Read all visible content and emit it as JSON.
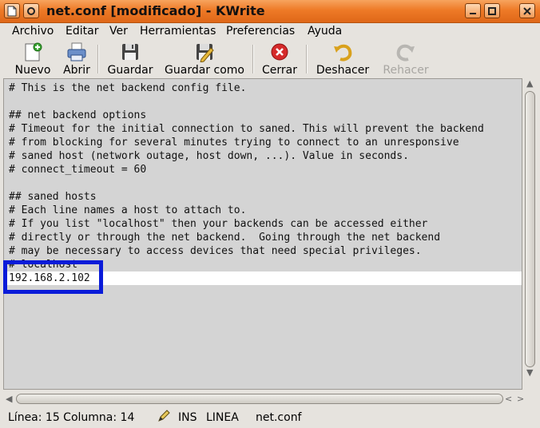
{
  "window": {
    "title": "net.conf [modificado] - KWrite",
    "icons": {
      "app": "document-icon",
      "menu": "window-menu-icon",
      "minimize": "minimize-icon",
      "maximize": "maximize-icon",
      "close": "close-x-icon"
    }
  },
  "menu": {
    "items": [
      "Archivo",
      "Editar",
      "Ver",
      "Herramientas",
      "Preferencias",
      "Ayuda"
    ]
  },
  "toolbar": {
    "nuevo": {
      "label": "Nuevo",
      "icon": "new-document-icon"
    },
    "abrir": {
      "label": "Abrir",
      "icon": "open-printer-icon"
    },
    "guardar": {
      "label": "Guardar",
      "icon": "floppy-disk-icon"
    },
    "guardar_como": {
      "label": "Guardar como",
      "icon": "save-as-icon"
    },
    "cerrar": {
      "label": "Cerrar",
      "icon": "close-red-icon"
    },
    "deshacer": {
      "label": "Deshacer",
      "icon": "undo-arrow-icon"
    },
    "rehacer": {
      "label": "Rehacer",
      "icon": "redo-arrow-icon",
      "disabled": true
    }
  },
  "editor": {
    "lines": [
      "# This is the net backend config file.",
      "",
      "## net backend options",
      "# Timeout for the initial connection to saned. This will prevent the backend",
      "# from blocking for several minutes trying to connect to an unresponsive",
      "# saned host (network outage, host down, ...). Value in seconds.",
      "# connect_timeout = 60",
      "",
      "## saned hosts",
      "# Each line names a host to attach to.",
      "# If you list \"localhost\" then your backends can be accessed either",
      "# directly or through the net backend.  Going through the net backend",
      "# may be necessary to access devices that need special privileges.",
      "# localhost",
      "192.168.2.102"
    ],
    "background": "#d4d4d4",
    "current_line_color": "#ffffff",
    "highlight_color": "#0a1bd9"
  },
  "status": {
    "position": "Línea: 15 Columna: 14",
    "mode": "INS",
    "line_mode": "LINEA",
    "filename": "net.conf",
    "icon": "pencil-modified-icon"
  }
}
